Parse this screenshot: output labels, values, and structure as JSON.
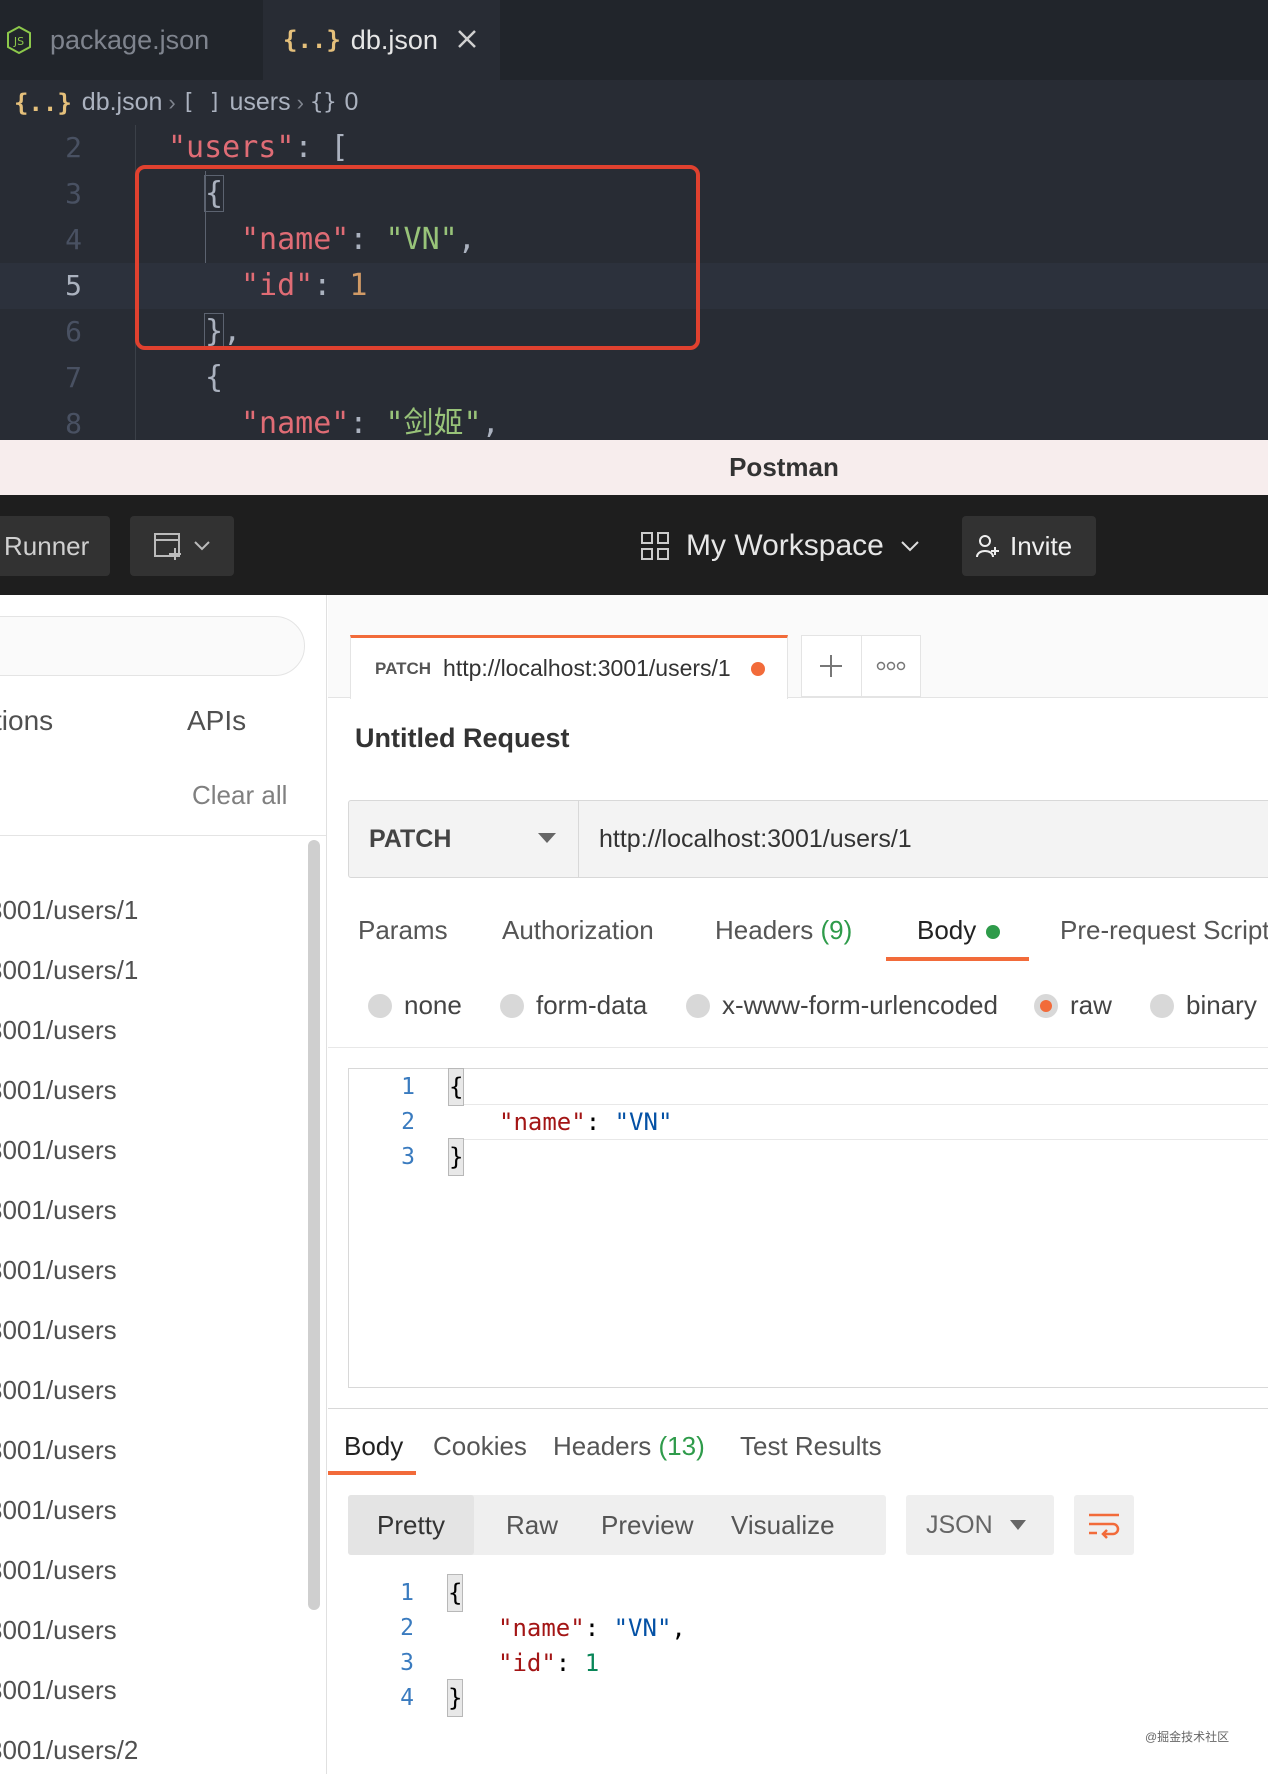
{
  "vscode": {
    "tabs": [
      {
        "label": "package.json",
        "icon": "nodejs-icon"
      },
      {
        "label": "db.json",
        "icon": "json-braces-icon",
        "active": true
      }
    ],
    "braces_glyph": "{..}",
    "breadcrumbs": {
      "file": "db.json",
      "array_glyph": "[ ]",
      "array_name": "users",
      "object_glyph": "{}",
      "object_name": "0"
    },
    "line_numbers": [
      "2",
      "3",
      "4",
      "5",
      "6",
      "7",
      "8"
    ],
    "code": {
      "users_key": "\"users\"",
      "name_key": "\"name\"",
      "id_key": "\"id\"",
      "value_vn": "\"VN\"",
      "value_id": "1",
      "value_jianji": "\"剑姬\""
    }
  },
  "postman": {
    "window_title": "Postman",
    "header": {
      "runner_label": "Runner",
      "workspace_label": "My Workspace",
      "invite_label": "Invite"
    },
    "sidebar": {
      "tab_collections": "tions",
      "tab_apis": "APIs",
      "clear_all": "Clear all",
      "history": [
        "3001/users/1",
        "3001/users/1",
        "3001/users",
        "3001/users",
        "3001/users",
        "3001/users",
        "3001/users",
        "3001/users",
        "3001/users",
        "3001/users",
        "3001/users",
        "3001/users",
        "3001/users",
        "3001/users",
        "3001/users/2"
      ]
    },
    "request_tab": {
      "method": "PATCH",
      "url": "http://localhost:3001/users/1"
    },
    "request_title": "Untitled Request",
    "url_bar": {
      "method": "PATCH",
      "url": "http://localhost:3001/users/1"
    },
    "request_tabs": {
      "params": "Params",
      "authorization": "Authorization",
      "headers": "Headers",
      "headers_count": "(9)",
      "body": "Body",
      "prerequest": "Pre-request Script"
    },
    "body_types": {
      "none": "none",
      "form_data": "form-data",
      "urlencoded": "x-www-form-urlencoded",
      "raw": "raw",
      "binary": "binary",
      "selected": "raw"
    },
    "body_editor": {
      "line_numbers": [
        "1",
        "2",
        "3"
      ],
      "name_key": "\"name\"",
      "name_value": "\"VN\""
    },
    "response_tabs": {
      "body": "Body",
      "cookies": "Cookies",
      "headers": "Headers",
      "headers_count": "(13)",
      "test_results": "Test Results"
    },
    "view_modes": {
      "pretty": "Pretty",
      "raw": "Raw",
      "preview": "Preview",
      "visualize": "Visualize"
    },
    "format": "JSON",
    "response_editor": {
      "line_numbers": [
        "1",
        "2",
        "3",
        "4"
      ],
      "name_key": "\"name\"",
      "name_value": "\"VN\"",
      "id_key": "\"id\"",
      "id_value": "1"
    }
  },
  "watermark": "@掘金技术社区",
  "colors": {
    "highlight_box": "#e0412f",
    "postman_accent": "#f26b3a",
    "count_green": "#2e9b4a"
  }
}
